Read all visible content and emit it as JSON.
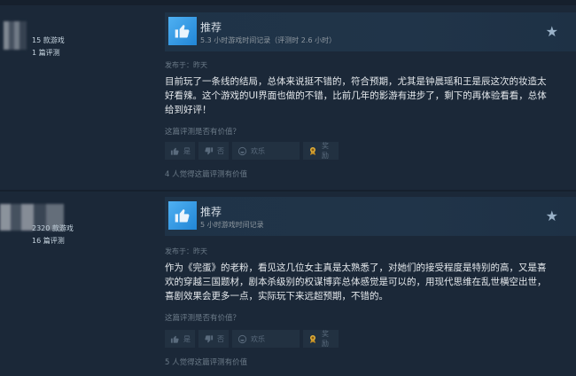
{
  "reviews": [
    {
      "author": {
        "games_owned": "15 款游戏",
        "review_count": "1 篇评测"
      },
      "recommendation": "推荐",
      "playtime": "5.3 小时游戏时间记录（评测时 2.6 小时）",
      "posted": "发布于：昨天",
      "text": "目前玩了一条线的结局，总体来说挺不错的，符合预期，尤其是钟晨瑶和王是辰这次的妆造太好看辣。这个游戏的UI界面也做的不错，比前几年的影游有进步了，剩下的再体验看看，总体给到好评！",
      "helpful_question": "这篇评测是否有价值？",
      "buttons": {
        "yes": "是",
        "no": "否",
        "funny": "欢乐",
        "award": "奖励"
      },
      "found_helpful": "4 人觉得这篇评测有价值"
    },
    {
      "author": {
        "games_owned": "2320 款游戏",
        "review_count": "16 篇评测"
      },
      "recommendation": "推荐",
      "playtime": "5 小时游戏时间记录",
      "posted": "发布于：昨天",
      "text": "作为《完蛋》的老粉，看见这几位女主真是太熟悉了，对她们的接受程度是特别的高，又是喜欢的穿越三国题材，剧本杀级别的权谋博弈总体感觉是可以的，用现代思维在乱世横空出世，喜剧效果会更多一点，实际玩下来远超预期，不错的。",
      "helpful_question": "这篇评测是否有价值？",
      "buttons": {
        "yes": "是",
        "no": "否",
        "funny": "欢乐",
        "award": "奖励"
      },
      "found_helpful": "5 人觉得这篇评测有价值"
    }
  ],
  "icons": {
    "thumbs_up": "thumbs-up-icon",
    "thumbs_down": "thumbs-down-icon",
    "funny": "laugh-icon",
    "award": "award-icon",
    "star": "star-icon"
  },
  "colors": {
    "background": "#1b2838",
    "recommend_accent": "#1a9fff",
    "award_gold": "#e3b23c"
  }
}
